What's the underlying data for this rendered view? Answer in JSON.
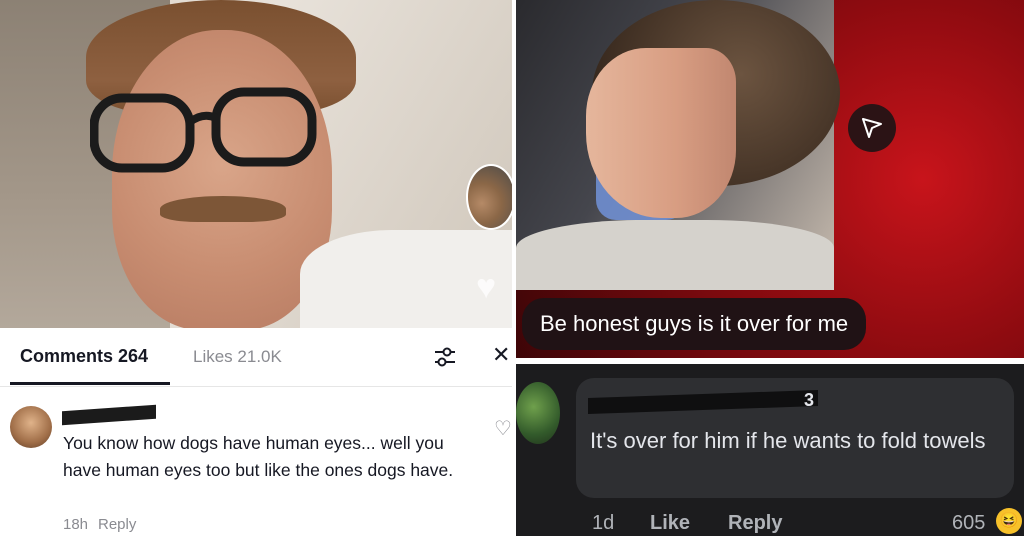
{
  "left": {
    "tabs": {
      "comments_label": "Comments 264",
      "likes_label": "Likes 21.0K"
    },
    "comment": {
      "text": "You know how dogs have human eyes... well you have human eyes too but like the ones dogs have.",
      "time": "18h",
      "reply_label": "Reply"
    }
  },
  "right": {
    "caption": "Be honest guys is it over for me",
    "comment": {
      "name_tail": "3",
      "text": "It's over for him if he wants to fold towels",
      "time": "1d",
      "like_label": "Like",
      "reply_label": "Reply",
      "reaction_count": "605"
    }
  },
  "icons": {
    "filter": "sliders-icon",
    "close": "close-icon",
    "heart": "heart-icon",
    "share": "send-arrow-icon",
    "reaction": "laughing-emoji-icon"
  }
}
